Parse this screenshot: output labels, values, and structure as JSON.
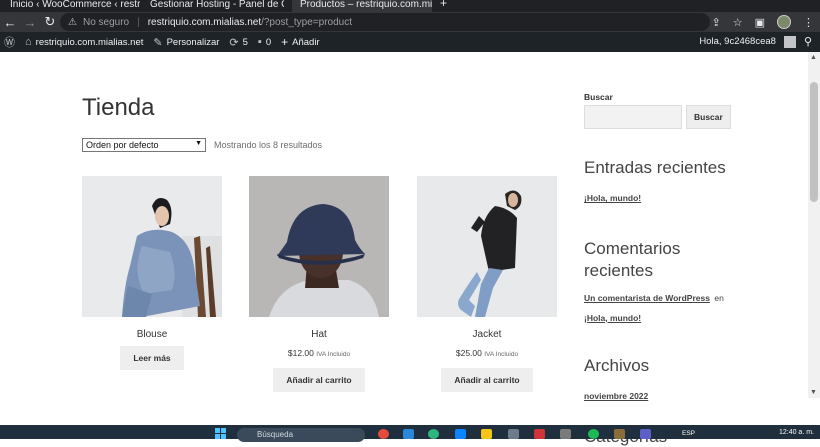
{
  "browser": {
    "tabs": [
      {
        "label": "Inicio ‹ WooCommerce ‹ restriqu"
      },
      {
        "label": "Gestionar Hosting - Panel de Co"
      },
      {
        "label": "Productos – restriquio.com.miali"
      }
    ],
    "address": {
      "security": "No seguro",
      "host": "restriquio.com.mialias.net",
      "path": "/?post_type=product"
    }
  },
  "admin_bar": {
    "site": "restriquio.com.mialias.net",
    "customize": "Personalizar",
    "updates_count": "5",
    "comments_count": "0",
    "new_label": "Añadir",
    "greeting": "Hola, 9c2468cea8"
  },
  "shop": {
    "title": "Tienda",
    "sort_selected": "Orden por defecto",
    "result_count": "Mostrando los 8 resultados",
    "products": [
      {
        "name": "Blouse",
        "price": "",
        "tax_note": "",
        "button": "Leer más"
      },
      {
        "name": "Hat",
        "price": "$12.00",
        "tax_note": "IVA Incluido",
        "button": "Añadir al carrito"
      },
      {
        "name": "Jacket",
        "price": "$25.00",
        "tax_note": "IVA Incluido",
        "button": "Añadir al carrito"
      }
    ]
  },
  "sidebar": {
    "search_label": "Buscar",
    "search_button": "Buscar",
    "recent_posts_title": "Entradas recientes",
    "recent_post": "¡Hola, mundo!",
    "recent_comments_title": "Comentarios recientes",
    "comment_author": "Un comentarista de WordPress",
    "comment_on": "en",
    "comment_post": "¡Hola, mundo!",
    "archives_title": "Archivos",
    "archive_month": "noviembre 2022",
    "categories_title": "Categorías"
  },
  "taskbar": {
    "search_placeholder": "Búsqueda",
    "language": "ESP",
    "clock": "12:40 a. m."
  },
  "colors": {
    "browser_chrome": "#35363a",
    "admin_bar": "#1d2327",
    "button_bg": "#eeeeee"
  }
}
